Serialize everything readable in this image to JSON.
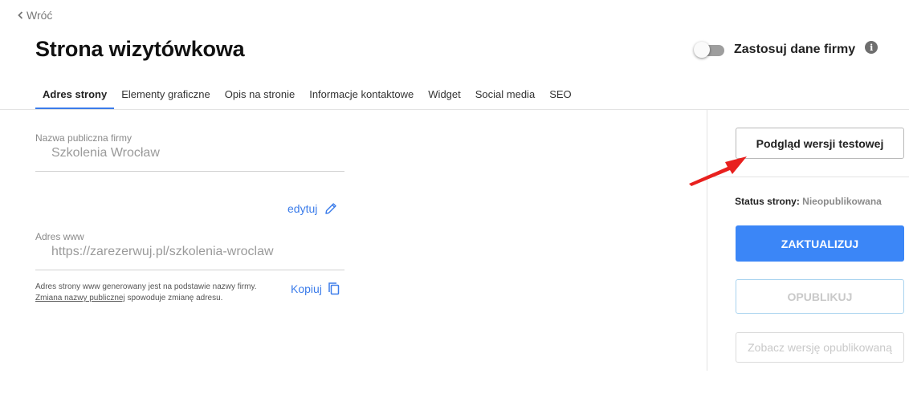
{
  "nav": {
    "back_label": "Wróć"
  },
  "page": {
    "title": "Strona wizytówkowa"
  },
  "toggle": {
    "label": "Zastosuj dane firmy",
    "on": false,
    "info": "i"
  },
  "tabs": [
    {
      "label": "Adres strony",
      "active": true
    },
    {
      "label": "Elementy graficzne"
    },
    {
      "label": "Opis na stronie"
    },
    {
      "label": "Informacje kontaktowe"
    },
    {
      "label": "Widget"
    },
    {
      "label": "Social media"
    },
    {
      "label": "SEO"
    }
  ],
  "form": {
    "company_name": {
      "label": "Nazwa publiczna firmy",
      "value": "Szkolenia Wrocław"
    },
    "edit_label": "edytuj",
    "www": {
      "label": "Adres www",
      "value": "https://zarezerwuj.pl/szkolenia-wroclaw"
    },
    "hint_line1": "Adres strony www generowany jest na podstawie nazwy firmy.",
    "hint_link": "Zmiana nazwy publicznej",
    "hint_line2_rest": " spowoduje zmianę adresu.",
    "copy_label": "Kopiuj"
  },
  "sidebar": {
    "preview_button": "Podgląd wersji testowej",
    "status_label": "Status strony:",
    "status_value": "Nieopublikowana",
    "update_button": "ZAKTUALIZUJ",
    "publish_button": "OPUBLIKUJ",
    "view_published_button": "Zobacz wersję opublikowaną"
  },
  "colors": {
    "accent": "#3b86f7",
    "link": "#3b7cea",
    "annotation_arrow": "#e8201e"
  }
}
